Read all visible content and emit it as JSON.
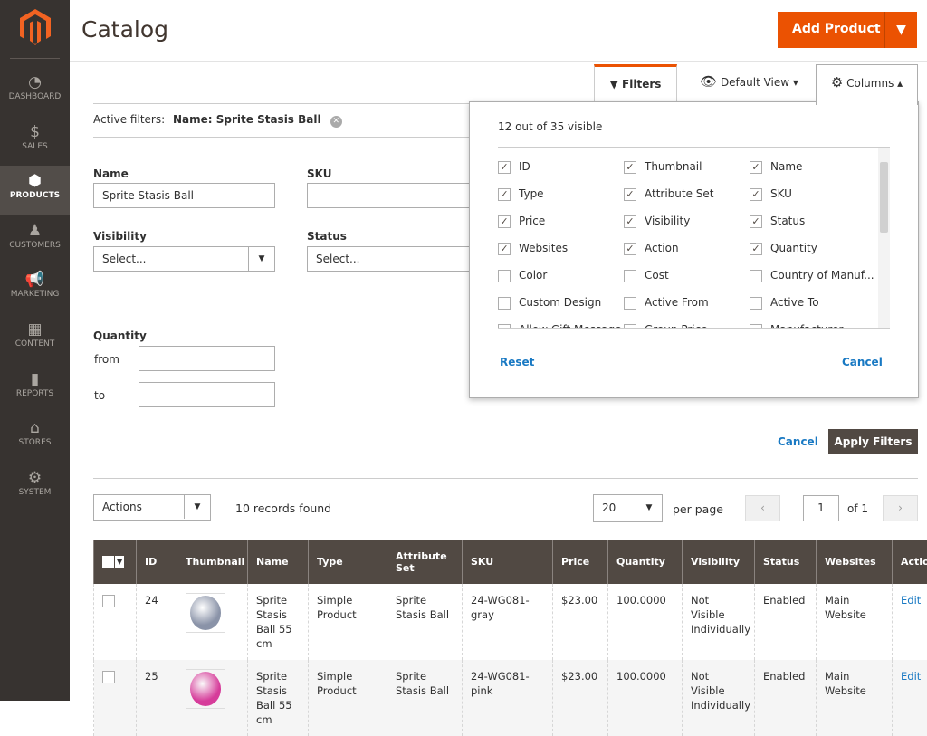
{
  "sidebar": {
    "items": [
      {
        "label": "DASHBOARD",
        "icon": "dashboard-gauge-icon",
        "glyph": "◔"
      },
      {
        "label": "SALES",
        "icon": "dollar-icon",
        "glyph": "$"
      },
      {
        "label": "PRODUCTS",
        "icon": "box-icon",
        "glyph": "⬢",
        "active": true
      },
      {
        "label": "CUSTOMERS",
        "icon": "person-icon",
        "glyph": "♟"
      },
      {
        "label": "MARKETING",
        "icon": "megaphone-icon",
        "glyph": "📢"
      },
      {
        "label": "CONTENT",
        "icon": "layout-icon",
        "glyph": "▦"
      },
      {
        "label": "REPORTS",
        "icon": "bar-chart-icon",
        "glyph": "▮"
      },
      {
        "label": "STORES",
        "icon": "storefront-icon",
        "glyph": "⌂"
      },
      {
        "label": "SYSTEM",
        "icon": "gear-icon",
        "glyph": "⚙"
      }
    ]
  },
  "header": {
    "title": "Catalog",
    "add_product": "Add Product"
  },
  "toolbar": {
    "filters": "Filters",
    "default_view": "Default View",
    "columns": "Columns"
  },
  "active_filters": {
    "label": "Active filters:",
    "chip": "Name: Sprite Stasis Ball"
  },
  "filters": {
    "name_label": "Name",
    "name_value": "Sprite Stasis Ball",
    "sku_label": "SKU",
    "visibility_label": "Visibility",
    "visibility_value": "Select...",
    "status_label": "Status",
    "status_value": "Select...",
    "quantity_label": "Quantity",
    "from": "from",
    "to": "to",
    "cancel": "Cancel",
    "apply": "Apply Filters"
  },
  "columns_panel": {
    "summary": "12 out of 35 visible",
    "reset": "Reset",
    "cancel": "Cancel",
    "items": [
      {
        "label": "ID",
        "checked": true
      },
      {
        "label": "Thumbnail",
        "checked": true
      },
      {
        "label": "Name",
        "checked": true
      },
      {
        "label": "Type",
        "checked": true
      },
      {
        "label": "Attribute Set",
        "checked": true
      },
      {
        "label": "SKU",
        "checked": true
      },
      {
        "label": "Price",
        "checked": true
      },
      {
        "label": "Visibility",
        "checked": true
      },
      {
        "label": "Status",
        "checked": true
      },
      {
        "label": "Websites",
        "checked": true
      },
      {
        "label": "Action",
        "checked": true
      },
      {
        "label": "Quantity",
        "checked": true
      },
      {
        "label": "Color",
        "checked": false
      },
      {
        "label": "Cost",
        "checked": false
      },
      {
        "label": "Country of Manuf...",
        "checked": false
      },
      {
        "label": "Custom Design",
        "checked": false
      },
      {
        "label": "Active From",
        "checked": false
      },
      {
        "label": "Active To",
        "checked": false
      },
      {
        "label": "Allow Gift Message",
        "checked": false
      },
      {
        "label": "Group Price",
        "checked": false
      },
      {
        "label": "Manufacturer",
        "checked": false
      }
    ]
  },
  "grid": {
    "actions": "Actions",
    "records": "10 records found",
    "per_page_value": "20",
    "per_page": "per page",
    "page": "1",
    "of": "of 1",
    "headers": [
      "",
      "ID",
      "Thumbnail",
      "Name",
      "Type",
      "Attribute Set",
      "SKU",
      "Price",
      "Quantity",
      "Visibility",
      "Status",
      "Websites",
      "Action"
    ],
    "rows": [
      {
        "id": "24",
        "color": "#8a93a8",
        "name": "Sprite Stasis Ball 55 cm",
        "type": "Simple Product",
        "attr": "Sprite Stasis Ball",
        "sku": "24-WG081-gray",
        "price": "$23.00",
        "qty": "100.0000",
        "vis": "Not Visible Individually",
        "status": "Enabled",
        "web": "Main Website",
        "action": "Edit"
      },
      {
        "id": "25",
        "color": "#d63c9a",
        "name": "Sprite Stasis Ball 55 cm",
        "type": "Simple Product",
        "attr": "Sprite Stasis Ball",
        "sku": "24-WG081-pink",
        "price": "$23.00",
        "qty": "100.0000",
        "vis": "Not Visible Individually",
        "status": "Enabled",
        "web": "Main Website",
        "action": "Edit"
      }
    ]
  },
  "colors": {
    "accent": "#eb5202",
    "sidebar": "#373330",
    "header_bg": "#514943",
    "link": "#1979c3"
  }
}
